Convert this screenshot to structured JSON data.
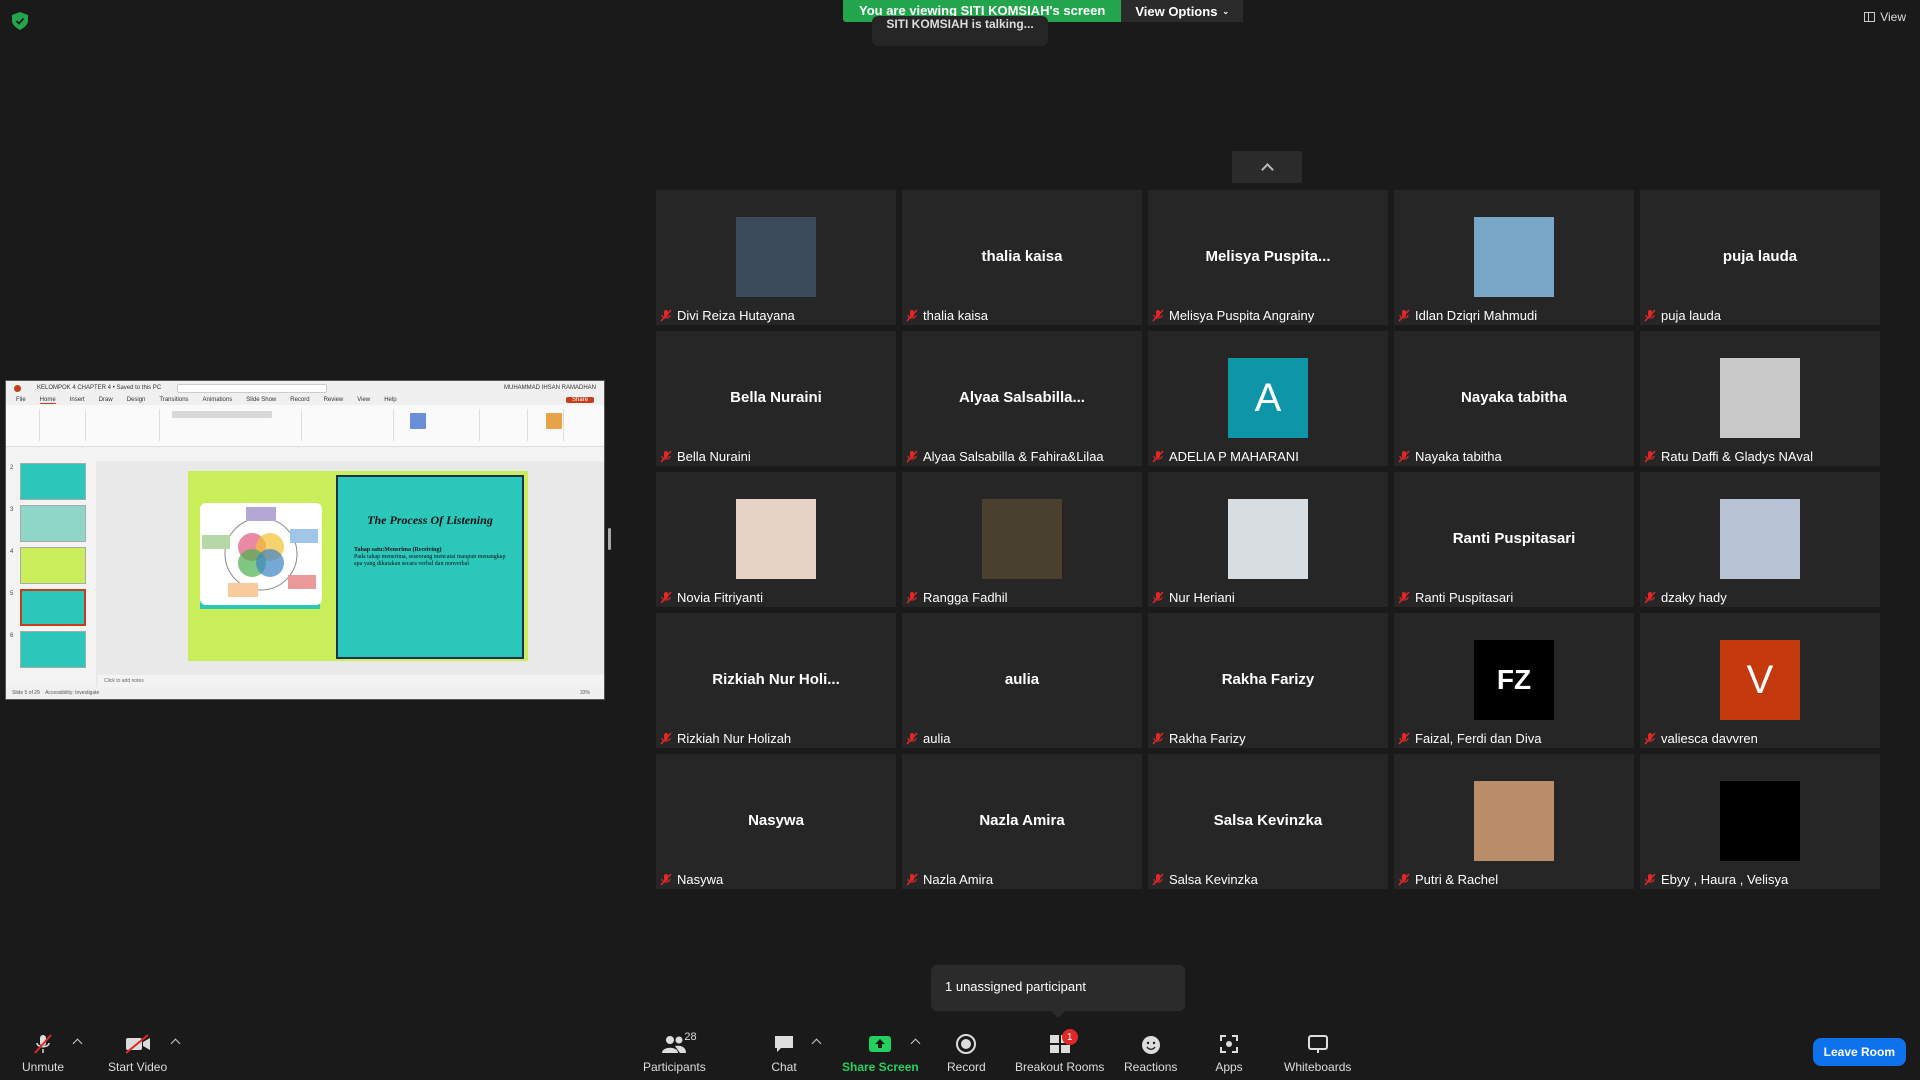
{
  "banner": {
    "viewing_text": "You are viewing SITI KOMSIAH's screen",
    "view_options_label": "View Options",
    "talking_text": "SITI KOMSIAH is talking...",
    "view_label": "View"
  },
  "share": {
    "app_title": "KELOMPOK 4 CHAPTER 4 • Saved to this PC",
    "user_name": "MUHAMMAD IHSAN RAMADHAN",
    "menu": [
      "File",
      "Home",
      "Insert",
      "Draw",
      "Design",
      "Transitions",
      "Animations",
      "Slide Show",
      "Record",
      "Review",
      "View",
      "Help"
    ],
    "share_label": "Share",
    "slide_title": "The Process Of Listening",
    "slide_bullet_1": "Tahap satu:Menerima (Receiving)",
    "slide_bullet_2": "Pada tahap menerima, seseorang mencatat maupun menangkap apa yang dikatakan secara verbal dan nonverbal",
    "notes_placeholder": "Click to add notes",
    "status_text": "Slide 5 of 29",
    "accessibility": "Accessibility: Investigate",
    "zoom": "33%",
    "thumb_numbers": [
      "2",
      "3",
      "4",
      "5",
      "6"
    ]
  },
  "participants": [
    {
      "name": "Divi Reiza Hutayana",
      "display": "",
      "avatar": "photo",
      "color": "#3a4a5a"
    },
    {
      "name": "thalia kaisa",
      "display": "thalia kaisa",
      "avatar": "none",
      "color": ""
    },
    {
      "name": "Melisya Puspita Angrainy",
      "display": "Melisya  Puspita...",
      "avatar": "none",
      "color": ""
    },
    {
      "name": "Idlan Dziqri Mahmudi",
      "display": "",
      "avatar": "photo",
      "color": "#7aa6c8"
    },
    {
      "name": "puja lauda",
      "display": "puja lauda",
      "avatar": "none",
      "color": ""
    },
    {
      "name": "Bella Nuraini",
      "display": "Bella Nuraini",
      "avatar": "none",
      "color": ""
    },
    {
      "name": "Alyaa Salsabilla & Fahira&Lilaa",
      "display": "Alyaa  Salsabilla...",
      "avatar": "none",
      "color": ""
    },
    {
      "name": "ADELIA P MAHARANI",
      "display": "A",
      "avatar": "letter",
      "color": "#0e96a8"
    },
    {
      "name": "Nayaka tabitha",
      "display": "Nayaka tabitha",
      "avatar": "none",
      "color": ""
    },
    {
      "name": "Ratu Daffi & Gladys NAval",
      "display": "",
      "avatar": "photo",
      "color": "#c9c9c9"
    },
    {
      "name": "Novia Fitriyanti",
      "display": "",
      "avatar": "photo",
      "color": "#e6d3c6"
    },
    {
      "name": "Rangga Fadhil",
      "display": "",
      "avatar": "photo",
      "color": "#4a4030"
    },
    {
      "name": "Nur Heriani",
      "display": "",
      "avatar": "photo",
      "color": "#d8dde2"
    },
    {
      "name": "Ranti Puspitasari",
      "display": "Ranti Puspitasari",
      "avatar": "none",
      "color": ""
    },
    {
      "name": "dzaky hady",
      "display": "",
      "avatar": "photo",
      "color": "#b8c3d6"
    },
    {
      "name": "Rizkiah Nur Holizah",
      "display": "Rizkiah  Nur  Holi...",
      "avatar": "none",
      "color": ""
    },
    {
      "name": "aulia",
      "display": "aulia",
      "avatar": "none",
      "color": ""
    },
    {
      "name": "Rakha Farizy",
      "display": "Rakha Farizy",
      "avatar": "none",
      "color": ""
    },
    {
      "name": "Faizal, Ferdi dan Diva",
      "display": "FZ",
      "avatar": "letter",
      "color": "#000000"
    },
    {
      "name": "valiesca davvren",
      "display": "V",
      "avatar": "letter",
      "color": "#c4390e"
    },
    {
      "name": "Nasywa",
      "display": "Nasywa",
      "avatar": "none",
      "color": ""
    },
    {
      "name": "Nazla Amira",
      "display": "Nazla Amira",
      "avatar": "none",
      "color": ""
    },
    {
      "name": "Salsa Kevinzka",
      "display": "Salsa Kevinzka",
      "avatar": "none",
      "color": ""
    },
    {
      "name": "Putri & Rachel",
      "display": "",
      "avatar": "photo",
      "color": "#b98d6a"
    },
    {
      "name": "Ebyy , Haura , Velisya",
      "display": "",
      "avatar": "photo",
      "color": "#000000"
    }
  ],
  "popup": {
    "unassigned_text": "1 unassigned participant"
  },
  "toolbar": {
    "unmute": "Unmute",
    "start_video": "Start Video",
    "participants": "Participants",
    "participants_count": "28",
    "chat": "Chat",
    "share_screen": "Share Screen",
    "record": "Record",
    "breakout_rooms": "Breakout Rooms",
    "breakout_badge": "1",
    "reactions": "Reactions",
    "apps": "Apps",
    "whiteboards": "Whiteboards",
    "leave_room": "Leave Room"
  },
  "colors": {
    "accent_green": "#23a54e",
    "leave_blue": "#0e72ed",
    "mute_red": "#e02828"
  }
}
